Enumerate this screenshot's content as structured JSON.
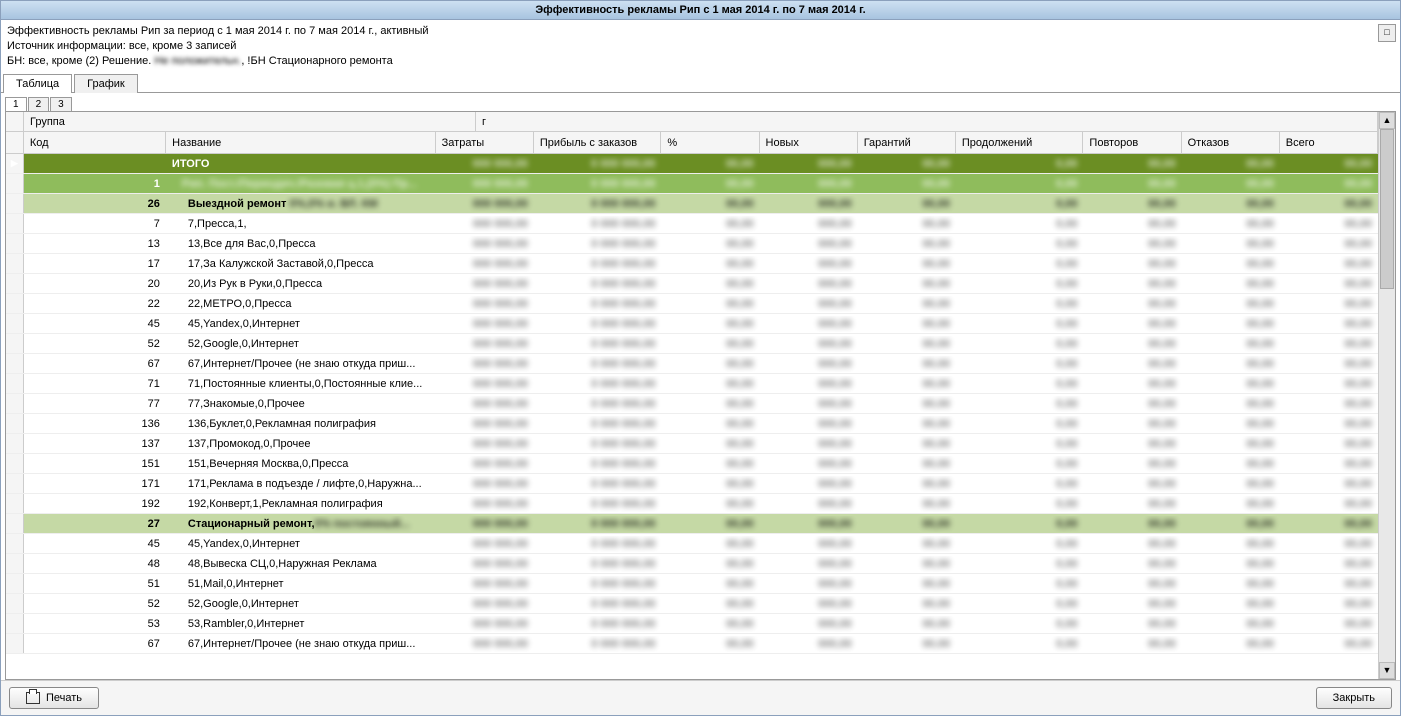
{
  "title": "Эффективность рекламы Рип с 1 мая 2014 г. по 7 мая 2014 г.",
  "info": {
    "line1": "Эффективность рекламы Рип за период с 1 мая 2014 г. по 7 мая 2014 г., активный",
    "line2": "Источник информации: все, кроме 3 записей",
    "line3a": "БН: все, кроме (2) Решение. ",
    "line3_blur": "Не положительн.",
    "line3b": ", !БН Стационарного ремонта"
  },
  "tabs": {
    "t1": "Таблица",
    "t2": "График"
  },
  "subtabs": {
    "s1": "1",
    "s2": "2",
    "s3": "3"
  },
  "bands": {
    "b1": "Группа",
    "b2": "г"
  },
  "cols": {
    "code": "Код",
    "name": "Название",
    "cost": "Затраты",
    "profit": "Прибыль с заказов",
    "pct": "%",
    "new": "Новых",
    "warr": "Гарантий",
    "cont": "Продолжений",
    "rep": "Повторов",
    "ref": "Отказов",
    "total": "Всего"
  },
  "rows": [
    {
      "lvl": 0,
      "code": "",
      "name": "ИТОГО",
      "indent": 0,
      "blurName": false
    },
    {
      "lvl": 1,
      "code": "1",
      "name": "Рип. Пост./Периодич./Разовая ц.1,(0%) Пр...",
      "indent": 1,
      "blurName": true
    },
    {
      "lvl": 2,
      "code": "26",
      "name": "Выездной ремонт,0%,0% и. ВЛ. КМ",
      "indent": 2,
      "blurName": true,
      "namePrefix": "Выездной ремонт "
    },
    {
      "lvl": 3,
      "code": "7",
      "name": "7,Пресса,1,",
      "indent": 3
    },
    {
      "lvl": 3,
      "code": "13",
      "name": "13,Все для Вас,0,Пресса",
      "indent": 3
    },
    {
      "lvl": 3,
      "code": "17",
      "name": "17,За Калужской Заставой,0,Пресса",
      "indent": 3
    },
    {
      "lvl": 3,
      "code": "20",
      "name": "20,Из Рук в Руки,0,Пресса",
      "indent": 3
    },
    {
      "lvl": 3,
      "code": "22",
      "name": "22,МЕТРО,0,Пресса",
      "indent": 3
    },
    {
      "lvl": 3,
      "code": "45",
      "name": "45,Yandex,0,Интернет",
      "indent": 3
    },
    {
      "lvl": 3,
      "code": "52",
      "name": "52,Google,0,Интернет",
      "indent": 3
    },
    {
      "lvl": 3,
      "code": "67",
      "name": "67,Интернет/Прочее (не знаю откуда приш...",
      "indent": 3
    },
    {
      "lvl": 3,
      "code": "71",
      "name": "71,Постоянные клиенты,0,Постоянные клие...",
      "indent": 3
    },
    {
      "lvl": 3,
      "code": "77",
      "name": "77,Знакомые,0,Прочее",
      "indent": 3
    },
    {
      "lvl": 3,
      "code": "136",
      "name": "136,Буклет,0,Рекламная полиграфия",
      "indent": 3
    },
    {
      "lvl": 3,
      "code": "137",
      "name": "137,Промокод,0,Прочее",
      "indent": 3
    },
    {
      "lvl": 3,
      "code": "151",
      "name": "151,Вечерняя Москва,0,Пресса",
      "indent": 3
    },
    {
      "lvl": 3,
      "code": "171",
      "name": "171,Реклама в подъезде / лифте,0,Наружна...",
      "indent": 3
    },
    {
      "lvl": 3,
      "code": "192",
      "name": "192,Конверт,1,Рекламная полиграфия",
      "indent": 3
    },
    {
      "lvl": 2,
      "code": "27",
      "name": "Стационарный ремонт,0% постоянный...",
      "indent": 2,
      "blurName": true,
      "namePrefix": "Стационарный ремонт,"
    },
    {
      "lvl": 3,
      "code": "45",
      "name": "45,Yandex,0,Интернет",
      "indent": 3
    },
    {
      "lvl": 3,
      "code": "48",
      "name": "48,Вывеска СЦ,0,Наружная Реклама",
      "indent": 3
    },
    {
      "lvl": 3,
      "code": "51",
      "name": "51,Mail,0,Интернет",
      "indent": 3
    },
    {
      "lvl": 3,
      "code": "52",
      "name": "52,Google,0,Интернет",
      "indent": 3
    },
    {
      "lvl": 3,
      "code": "53",
      "name": "53,Rambler,0,Интернет",
      "indent": 3
    },
    {
      "lvl": 3,
      "code": "67",
      "name": "67,Интернет/Прочее (не знаю откуда приш...",
      "indent": 3
    }
  ],
  "footer": {
    "print": "Печать",
    "close": "Закрыть"
  },
  "maximize_icon": "□"
}
